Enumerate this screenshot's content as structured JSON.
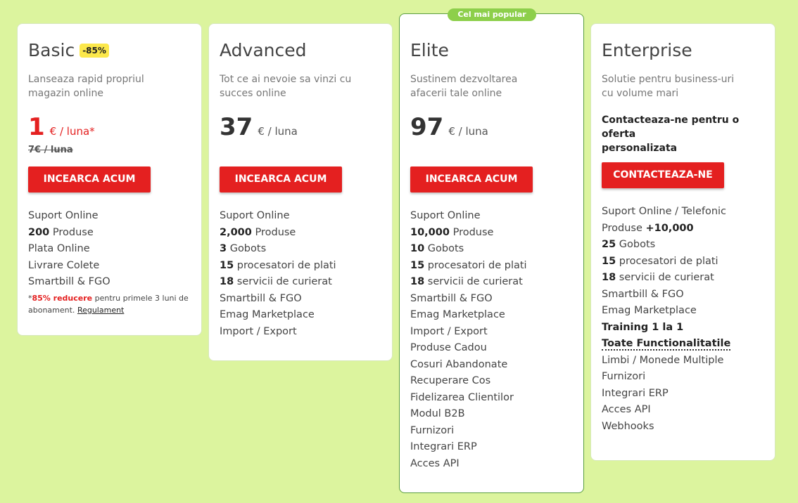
{
  "plans": [
    {
      "id": "basic",
      "title": "Basic",
      "badge": "-85%",
      "subtitle_line1": "Lanseaza rapid propriul",
      "subtitle_line2": "magazin online",
      "price": "1",
      "unit": "€ / luna*",
      "old_price": "7€ / luna",
      "cta": "INCEARCA ACUM",
      "features": [
        {
          "bold": "",
          "text": "Suport Online"
        },
        {
          "bold": "200",
          "text": " Produse"
        },
        {
          "bold": "",
          "text": "Plata Online"
        },
        {
          "bold": "",
          "text": "Livrare Colete"
        },
        {
          "bold": "",
          "text": "Smartbill & FGO"
        }
      ],
      "note": {
        "star": "*",
        "highlight": "85% reducere",
        "text": " pentru primele 3 luni de abonament. ",
        "link": "Regulament"
      }
    },
    {
      "id": "advanced",
      "title": "Advanced",
      "subtitle_line1": "Tot ce ai nevoie sa vinzi cu",
      "subtitle_line2": "succes online",
      "price": "37",
      "unit": "€ / luna",
      "cta": "INCEARCA ACUM",
      "features": [
        {
          "bold": "",
          "text": "Suport Online"
        },
        {
          "bold": "2,000",
          "text": " Produse"
        },
        {
          "bold": "3",
          "text": " Gobots"
        },
        {
          "bold": "15",
          "text": " procesatori de plati"
        },
        {
          "bold": "18",
          "text": " servicii de curierat"
        },
        {
          "bold": "",
          "text": "Smartbill & FGO"
        },
        {
          "bold": "",
          "text": "Emag Marketplace"
        },
        {
          "bold": "",
          "text": "Import / Export"
        }
      ]
    },
    {
      "id": "elite",
      "title": "Elite",
      "popular_label": "Cel mai popular",
      "subtitle_line1": "Sustinem dezvoltarea",
      "subtitle_line2": "afacerii tale online",
      "price": "97",
      "unit": "€ / luna",
      "cta": "INCEARCA ACUM",
      "features": [
        {
          "bold": "",
          "text": "Suport Online"
        },
        {
          "bold": "10,000",
          "text": " Produse"
        },
        {
          "bold": "10",
          "text": " Gobots"
        },
        {
          "bold": "15",
          "text": " procesatori de plati"
        },
        {
          "bold": "18",
          "text": " servicii de curierat"
        },
        {
          "bold": "",
          "text": "Smartbill & FGO"
        },
        {
          "bold": "",
          "text": "Emag Marketplace"
        },
        {
          "bold": "",
          "text": "Import / Export"
        },
        {
          "bold": "",
          "text": "Produse Cadou"
        },
        {
          "bold": "",
          "text": "Cosuri Abandonate"
        },
        {
          "bold": "",
          "text": "Recuperare Cos"
        },
        {
          "bold": "",
          "text": "Fidelizarea Clientilor"
        },
        {
          "bold": "",
          "text": "Modul B2B"
        },
        {
          "bold": "",
          "text": "Furnizori"
        },
        {
          "bold": "",
          "text": "Integrari ERP"
        },
        {
          "bold": "",
          "text": "Acces API"
        }
      ]
    },
    {
      "id": "enterprise",
      "title": "Enterprise",
      "subtitle_line1": "Solutie pentru business-uri",
      "subtitle_line2": "cu volume mari",
      "contact_line1": "Contacteaza-ne pentru o oferta",
      "contact_line2": "personalizata",
      "cta": "CONTACTEAZA-NE",
      "features": [
        {
          "bold": "",
          "text": "Suport Online / Telefonic"
        },
        {
          "bold": "",
          "text": "Produse ",
          "bold_after": "+10,000"
        },
        {
          "bold": "25",
          "text": " Gobots"
        },
        {
          "bold": "15",
          "text": " procesatori de plati"
        },
        {
          "bold": "18",
          "text": " servicii de curierat"
        },
        {
          "bold": "",
          "text": "Smartbill & FGO"
        },
        {
          "bold": "",
          "text": "Emag Marketplace"
        },
        {
          "bold": "Training 1 la 1",
          "text": ""
        },
        {
          "bold": "Toate Functionalitatile",
          "text": "",
          "dotted": true
        },
        {
          "bold": "",
          "text": "Limbi / Monede Multiple"
        },
        {
          "bold": "",
          "text": "Furnizori"
        },
        {
          "bold": "",
          "text": "Integrari ERP"
        },
        {
          "bold": "",
          "text": "Acces API"
        },
        {
          "bold": "",
          "text": "Webhooks"
        }
      ]
    }
  ],
  "colors": {
    "background": "#dcf49e",
    "cta": "#e42020",
    "popular": "#8dcf4b",
    "badge": "#fce84b",
    "elite_border": "#5a9e3e"
  }
}
